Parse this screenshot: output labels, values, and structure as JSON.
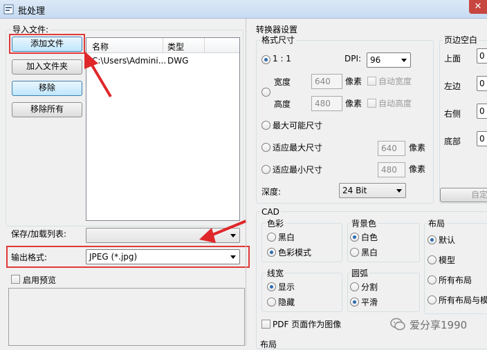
{
  "window": {
    "title": "批处理",
    "close_glyph": "✕"
  },
  "import_files": {
    "legend": "导入文件:",
    "add_files": "添加文件",
    "add_folder": "加入文件夹",
    "remove": "移除",
    "remove_all": "移除所有",
    "columns": [
      "名称",
      "类型"
    ],
    "rows": [
      {
        "name": "C:\\Users\\Admini...",
        "type": "DWG"
      }
    ]
  },
  "save_load_list": {
    "label": "保存/加载列表:",
    "value": ""
  },
  "output_format": {
    "label": "输出格式:",
    "value": "JPEG (*.jpg)"
  },
  "preview": {
    "label": "启用预览",
    "checked": false
  },
  "converter_settings": {
    "legend": "转换器设置",
    "format_size": {
      "legend": "格式尺寸",
      "ratio_label": "1 : 1",
      "dpi_label": "DPI:",
      "dpi_value": "96",
      "width_label": "宽度",
      "width_value": "640",
      "height_label": "高度",
      "height_value": "480",
      "pixel_unit": "像素",
      "auto_width": "自动宽度",
      "auto_height": "自动高度",
      "max_possible": "最大可能尺寸",
      "fit_max": "适应最大尺寸",
      "fit_max_value": "640",
      "fit_min": "适应最小尺寸",
      "fit_min_value": "480",
      "depth_label": "深度:",
      "depth_value": "24 Bit"
    },
    "page_margins": {
      "legend": "页边空白",
      "top": "上面",
      "left": "左边",
      "right": "右侧",
      "bottom": "底部",
      "top_value": "0",
      "left_value": "0",
      "right_value": "0",
      "bottom_value": "0",
      "custom_button": "自定"
    }
  },
  "cad": {
    "legend": "CAD",
    "color": {
      "legend": "色彩",
      "bw": "黑白",
      "color_mode": "色彩模式",
      "selected": "color_mode"
    },
    "background": {
      "legend": "背景色",
      "white": "白色",
      "black": "黑白",
      "selected": "white"
    },
    "layout": {
      "legend": "布局",
      "default": "默认",
      "model": "模型",
      "all_layouts": "所有布局",
      "all_layouts_model": "所有布局与模",
      "selected": "default"
    },
    "line_width": {
      "legend": "线宽",
      "show": "显示",
      "hide": "隐藏",
      "selected": "show"
    },
    "arc": {
      "legend": "圆弧",
      "split": "分割",
      "smooth": "平滑",
      "selected": "smooth"
    },
    "pdf_as_image": "PDF 页面作为图像",
    "layout_bottom": "布局"
  },
  "watermark": {
    "text": "爱分享1990"
  },
  "colors": {
    "accent": "#2c6bb0",
    "annotation_red": "#e0272a"
  }
}
